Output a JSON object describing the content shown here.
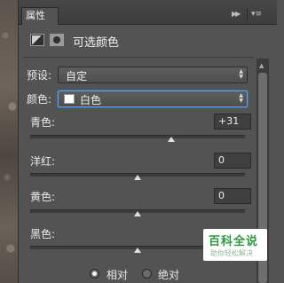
{
  "panel": {
    "tab_label": "属性",
    "collapse_icon": "double-chevron-right-icon",
    "menu_icon": "panel-menu-icon",
    "title": "可选颜色"
  },
  "preset": {
    "label": "预设:",
    "value": "自定"
  },
  "colors": {
    "label": "颜色:",
    "value": "白色",
    "swatch_color": "#ffffff"
  },
  "sliders": [
    {
      "label": "青色:",
      "value": "+31",
      "unit": "%",
      "level": 0.655
    },
    {
      "label": "洋红:",
      "value": "0",
      "unit": "%",
      "level": 0.5
    },
    {
      "label": "黄色:",
      "value": "0",
      "unit": "%",
      "level": 0.5
    },
    {
      "label": "黑色:",
      "value": "",
      "unit": "",
      "level": 0.5
    }
  ],
  "method": {
    "options": [
      {
        "label": "相对",
        "selected": true
      },
      {
        "label": "绝对",
        "selected": false
      }
    ]
  },
  "watermark": {
    "title": "百科全说",
    "subtitle": "助你轻松解决"
  },
  "colors_theme": {
    "panel_bg": "#535353",
    "focus_border": "#6a9fd6",
    "watermark_green": "#2a9a3c"
  }
}
